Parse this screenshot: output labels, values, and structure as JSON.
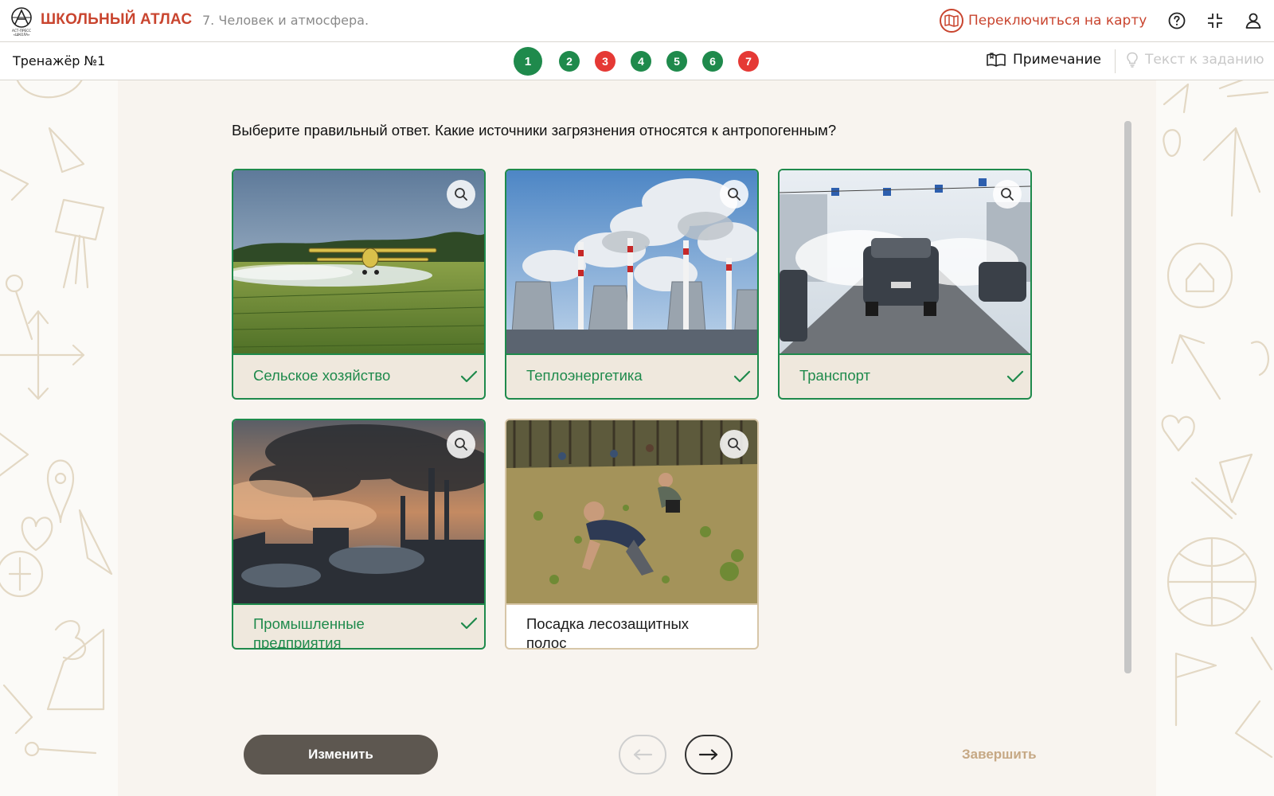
{
  "header": {
    "brand": "ШКОЛЬНЫЙ АТЛАС",
    "logo_text_top": "АСТ-ПРЕСС",
    "logo_text_bottom": "«ШКОЛА»",
    "section": "7. Человек и атмосфера.",
    "switch_map_label": "Переключиться на карту",
    "icons": [
      "map-icon",
      "help-icon",
      "collapse-icon",
      "user-icon"
    ]
  },
  "subbar": {
    "trainer_title": "Тренажёр №1",
    "steps": [
      {
        "number": "1",
        "status": "correct",
        "current": true
      },
      {
        "number": "2",
        "status": "correct",
        "current": false
      },
      {
        "number": "3",
        "status": "wrong",
        "current": false
      },
      {
        "number": "4",
        "status": "correct",
        "current": false
      },
      {
        "number": "5",
        "status": "correct",
        "current": false
      },
      {
        "number": "6",
        "status": "correct",
        "current": false
      },
      {
        "number": "7",
        "status": "wrong",
        "current": false
      }
    ],
    "note_label": "Примечание",
    "task_text_label": "Текст к заданию"
  },
  "question": "Выберите правильный ответ. Какие источники загрязнения относятся к антропогенным?",
  "answers": [
    {
      "label": "Сельское хозяйство",
      "selected": true,
      "image": "crop-duster-plane"
    },
    {
      "label": "Теплоэнергетика",
      "selected": true,
      "image": "power-plant-smoke"
    },
    {
      "label": "Транспорт",
      "selected": true,
      "image": "traffic-exhaust"
    },
    {
      "label": "Промышленные предприятия",
      "selected": true,
      "image": "industrial-smoke"
    },
    {
      "label": "Посадка лесозащитных полос",
      "selected": false,
      "image": "tree-planting"
    }
  ],
  "controls": {
    "change_label": "Изменить",
    "finish_label": "Завершить"
  },
  "colors": {
    "brand": "#c9452f",
    "correct": "#1f8a4c",
    "wrong": "#e53935",
    "panel": "#f8f4ef",
    "button_dark": "#5d5750",
    "finish": "#c6a884"
  }
}
